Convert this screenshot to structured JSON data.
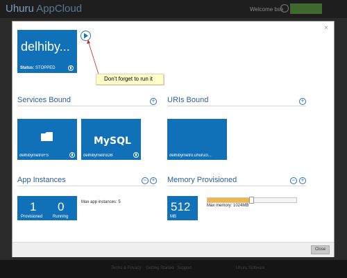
{
  "header": {
    "brand_prefix": "Uhuru",
    "brand_name": "AppCloud",
    "welcome": "Welcome bse"
  },
  "footer": {
    "links": [
      "Terms & Privacy",
      "Getting Started",
      "Support",
      "Uhuru Software"
    ]
  },
  "app": {
    "name": "delhiby...",
    "status_label": "Status:",
    "status_value": "STOPPED"
  },
  "callout": {
    "text": "Don't forget to run it"
  },
  "services": {
    "title": "Services Bound",
    "items": [
      {
        "label": "delhibymetroFS",
        "icon": "folder-icon"
      },
      {
        "label": "delhibymetroDB",
        "icon": "mysql-logo",
        "logo_text": "MySQL"
      }
    ]
  },
  "uris": {
    "title": "URIs Bound",
    "items": [
      {
        "label": "delhibymetro.uhurucl..."
      }
    ]
  },
  "instances": {
    "title": "App Instances",
    "provisioned_value": "1",
    "provisioned_label": "Provisioned",
    "running_value": "0",
    "running_label": "Running",
    "max_text": "Max app instances: 5"
  },
  "memory": {
    "title": "Memory Provisioned",
    "value": "512",
    "unit": "MB",
    "max_text": "Max memory: 1024MB",
    "fill_fraction": 0.5
  },
  "dialog": {
    "close_label": "Close"
  },
  "colors": {
    "tile": "#1071b9",
    "accent": "#2b5e9c",
    "callout": "#ffffcc",
    "memory_bar": "#f2b445"
  }
}
